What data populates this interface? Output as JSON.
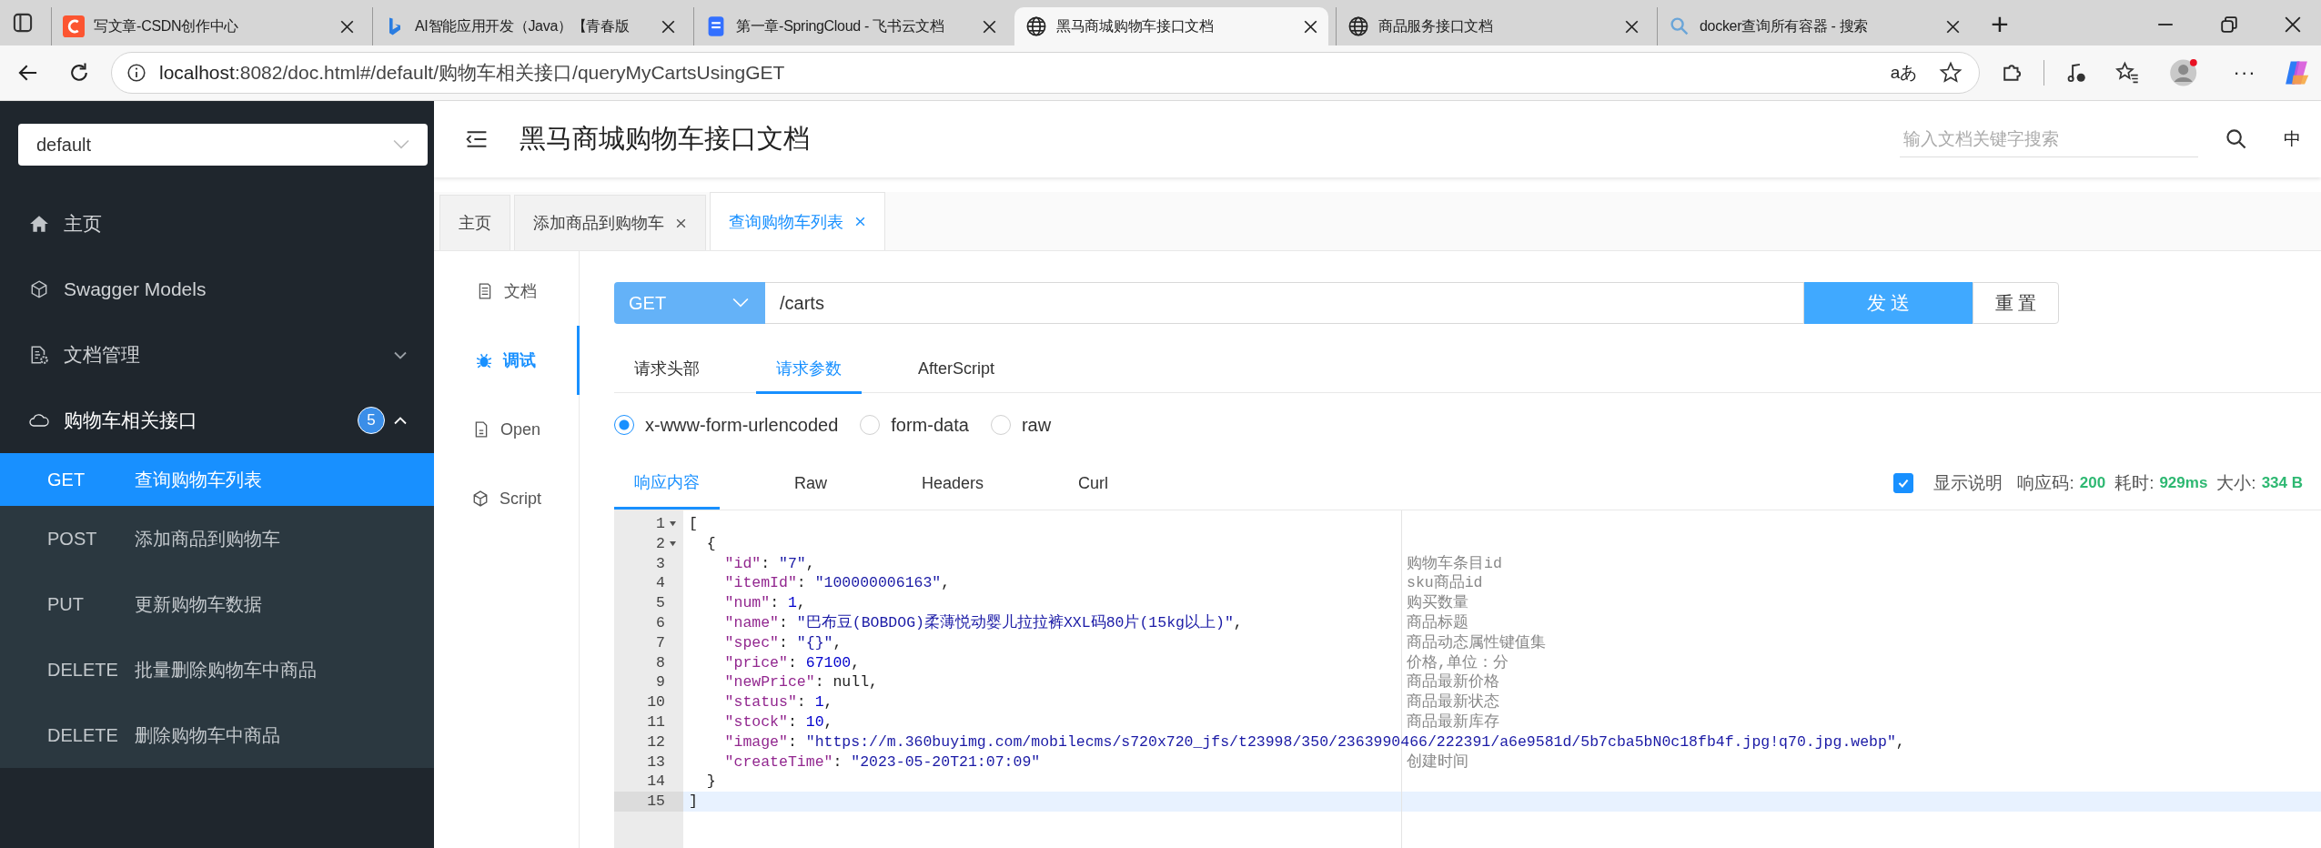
{
  "browser": {
    "tabs": [
      {
        "kind": "red",
        "title": "写文章-CSDN创作中心",
        "selected": false
      },
      {
        "kind": "swirl",
        "title": "AI智能应用开发（Java）【青春版",
        "selected": false
      },
      {
        "kind": "doc",
        "title": "第一章-SpringCloud - 飞书云文档",
        "selected": false
      },
      {
        "kind": "globe",
        "title": "黑马商城购物车接口文档",
        "selected": true
      },
      {
        "kind": "globe",
        "title": "商品服务接口文档",
        "selected": false
      },
      {
        "kind": "search",
        "title": "docker查询所有容器 - 搜索",
        "selected": false
      }
    ],
    "new_tab": "+",
    "url_host": "localhost",
    "url_rest": ":8082/doc.html#/default/购物车相关接口/queryMyCartsUsingGET",
    "read_aloud": "aあ",
    "more": "···"
  },
  "sidebar": {
    "group_select": "default",
    "items": [
      {
        "kind": "home",
        "label": "主页"
      },
      {
        "kind": "cube",
        "label": "Swagger Models"
      },
      {
        "kind": "docgear",
        "label": "文档管理",
        "expanded": false
      },
      {
        "kind": "cloud",
        "label": "购物车相关接口",
        "badge": "5",
        "expanded": true,
        "children": [
          {
            "method": "GET",
            "label": "查询购物车列表",
            "selected": true
          },
          {
            "method": "POST",
            "label": "添加商品到购物车",
            "selected": false
          },
          {
            "method": "PUT",
            "label": "更新购物车数据",
            "selected": false
          },
          {
            "method": "DELETE",
            "label": "批量删除购物车中商品",
            "selected": false
          },
          {
            "method": "DELETE",
            "label": "删除购物车中商品",
            "selected": false
          }
        ]
      }
    ]
  },
  "header": {
    "title": "黑马商城购物车接口文档",
    "search_placeholder": "输入文档关键字搜索",
    "language": "中"
  },
  "page_tabs": [
    {
      "label": "主页",
      "closable": false,
      "selected": false
    },
    {
      "label": "添加商品到购物车",
      "closable": true,
      "selected": false
    },
    {
      "label": "查询购物车列表",
      "closable": true,
      "selected": true
    }
  ],
  "sub_nav": [
    {
      "kind": "doc",
      "label": "文档",
      "selected": false
    },
    {
      "kind": "bug",
      "label": "调试",
      "selected": true
    },
    {
      "kind": "file",
      "label": "Open",
      "selected": false
    },
    {
      "kind": "cube",
      "label": "Script",
      "selected": false
    }
  ],
  "request": {
    "method": "GET",
    "url": "/carts",
    "send": "发 送",
    "reset": "重 置"
  },
  "param_tabs": [
    {
      "label": "请求头部",
      "selected": false
    },
    {
      "label": "请求参数",
      "selected": true
    },
    {
      "label": "AfterScript",
      "selected": false
    }
  ],
  "body_types": [
    {
      "label": "x-www-form-urlencoded",
      "selected": true
    },
    {
      "label": "form-data",
      "selected": false
    },
    {
      "label": "raw",
      "selected": false
    }
  ],
  "response_tabs": [
    {
      "label": "响应内容",
      "selected": true
    },
    {
      "label": "Raw",
      "selected": false
    },
    {
      "label": "Headers",
      "selected": false
    },
    {
      "label": "Curl",
      "selected": false
    }
  ],
  "response_meta": {
    "show_desc_label": "显示说明",
    "show_desc": true,
    "code_label": "响应码:",
    "code": "200",
    "time_label": "耗时:",
    "time": "929ms",
    "size_label": "大小:",
    "size": "334 B"
  },
  "code_lines": [
    {
      "number": "1",
      "text": "[",
      "fold": true
    },
    {
      "number": "2",
      "text": "  {",
      "fold": true
    },
    {
      "number": "3",
      "text": "    \"id\": \"7\",",
      "comment": "购物车条目id"
    },
    {
      "number": "4",
      "text": "    \"itemId\": \"100000006163\",",
      "comment": "sku商品id"
    },
    {
      "number": "5",
      "text": "    \"num\": 1,",
      "comment": "购买数量"
    },
    {
      "number": "6",
      "text": "    \"name\": \"巴布豆(BOBDOG)柔薄悦动婴儿拉拉裤XXL码80片(15kg以上)\",",
      "comment": "商品标题"
    },
    {
      "number": "7",
      "text": "    \"spec\": \"{}\",",
      "comment": "商品动态属性键值集"
    },
    {
      "number": "8",
      "text": "    \"price\": 67100,",
      "comment": "价格,单位：分"
    },
    {
      "number": "9",
      "text": "    \"newPrice\": null,",
      "comment": "商品最新价格"
    },
    {
      "number": "10",
      "text": "    \"status\": 1,",
      "comment": "商品最新状态"
    },
    {
      "number": "11",
      "text": "    \"stock\": 10,",
      "comment": "商品最新库存"
    },
    {
      "number": "12",
      "text": "    \"image\": \"https://m.360buyimg.com/mobilecms/s720x720_jfs/t23998/350/2363990466/222391/a6e9581d/5b7cba5bN0c18fb4f.jpg!q70.jpg.webp\","
    },
    {
      "number": "13",
      "text": "    \"createTime\": \"2023-05-20T21:07:09\"",
      "comment": "创建时间"
    },
    {
      "number": "14",
      "text": "  }"
    },
    {
      "number": "15",
      "text": "]",
      "active": true
    }
  ]
}
